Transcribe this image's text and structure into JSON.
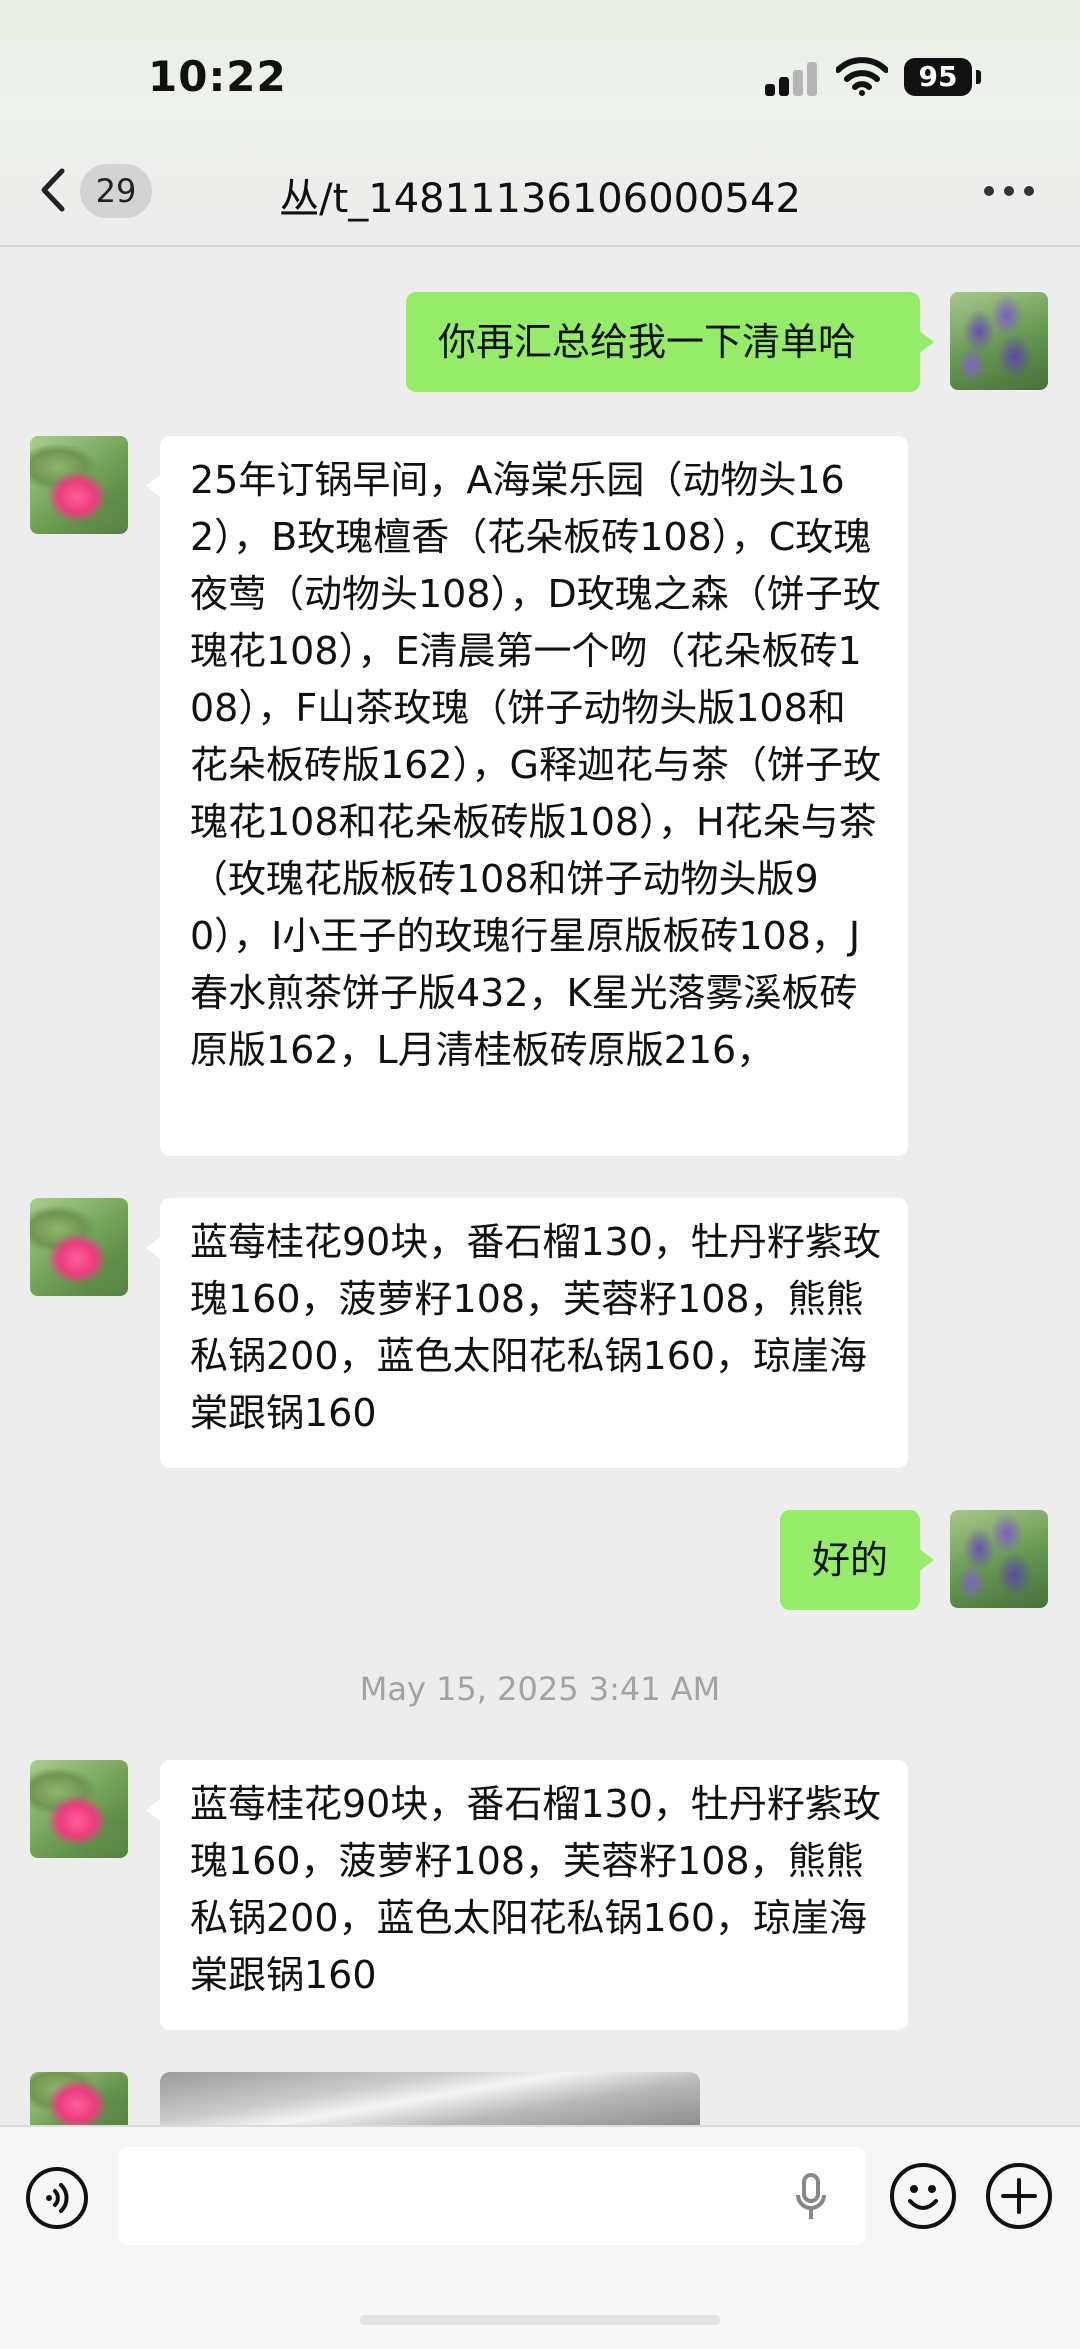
{
  "status_bar": {
    "time": "10:22",
    "battery": "95"
  },
  "header": {
    "unread_count": "29",
    "title": "丛/t_14811136106000542"
  },
  "messages": [
    {
      "side": "self",
      "text": "你再汇总给我一下清单哈"
    },
    {
      "side": "other",
      "text": " 25年订锅早间，A海棠乐园（动物头162），B玫瑰檀香（花朵板砖108），C玫瑰夜莺（动物头108），D玫瑰之森（饼子玫瑰花108），E清晨第一个吻（花朵板砖108），F山茶玫瑰（饼子动物头版108和花朵板砖版162），G释迦花与茶（饼子玫瑰花108和花朵板砖版108），H花朵与茶（玫瑰花版板砖108和饼子动物头版90），I小王子的玫瑰行星原版板砖108，J春水煎茶饼子版432，K星光落雾溪板砖原版162，L月清桂板砖原版216，"
    },
    {
      "side": "other",
      "text": "蓝莓桂花90块，番石榴130，牡丹籽紫玫瑰160，菠萝籽108，芙蓉籽108，熊熊私锅200，蓝色太阳花私锅160，琼崖海棠跟锅160"
    },
    {
      "side": "self",
      "text": "好的"
    },
    {
      "side": "other",
      "text": "蓝莓桂花90块，番石榴130，牡丹籽紫玫瑰160，菠萝籽108，芙蓉籽108，熊熊私锅200，蓝色太阳花私锅160，琼崖海棠跟锅160"
    }
  ],
  "timestamp": "May 15, 2025 3:41 AM",
  "colors": {
    "self_bubble": "#95ec69",
    "other_bubble": "#ffffff",
    "background": "#ededed"
  },
  "icons": {
    "back": "chevron-left-icon",
    "more": "more-dots-icon",
    "voice": "voice-icon",
    "mic": "mic-icon",
    "emoji": "emoji-icon",
    "plus": "plus-icon"
  }
}
